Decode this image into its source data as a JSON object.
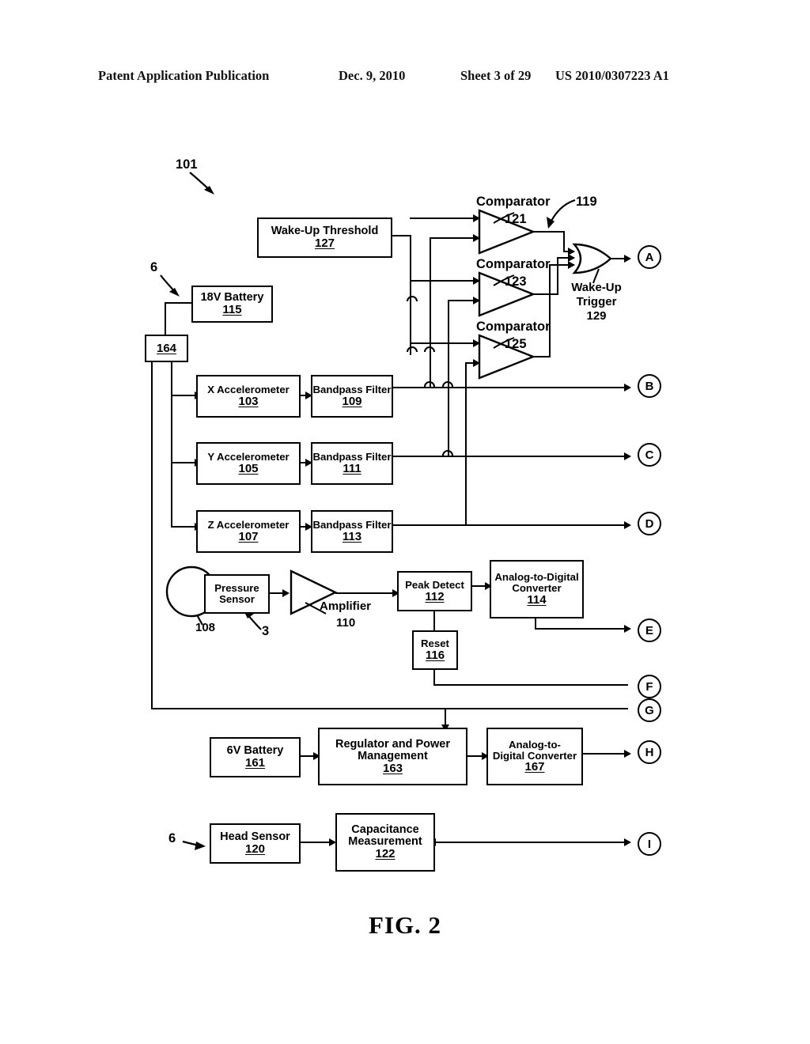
{
  "header": {
    "publication": "Patent Application Publication",
    "date": "Dec. 9, 2010",
    "sheet": "Sheet 3 of 29",
    "number": "US 2010/0307223 A1"
  },
  "figure": {
    "caption": "FIG. 2",
    "system_ref": "101",
    "group_ref_top": "6",
    "group_ref_bottom": "6",
    "group_ref_sensor": "3"
  },
  "blocks": {
    "wake_threshold": {
      "label": "Wake-Up Threshold",
      "num": "127"
    },
    "battery18": {
      "label": "18V Battery",
      "num": "115"
    },
    "node164": {
      "num": "164"
    },
    "x_accel": {
      "label": "X Accelerometer",
      "num": "103"
    },
    "y_accel": {
      "label": "Y Accelerometer",
      "num": "105"
    },
    "z_accel": {
      "label": "Z Accelerometer",
      "num": "107"
    },
    "bpf_x": {
      "label": "Bandpass Filter",
      "num": "109"
    },
    "bpf_y": {
      "label": "Bandpass Filter",
      "num": "111"
    },
    "bpf_z": {
      "label": "Bandpass Filter",
      "num": "113"
    },
    "pressure_sensor": {
      "label_line1": "Pressure",
      "label_line2": "Sensor",
      "num": "108"
    },
    "amplifier": {
      "label": "Amplifier",
      "num": "110"
    },
    "peak_detect": {
      "label": "Peak Detect",
      "num": "112"
    },
    "adc114": {
      "label_line1": "Analog-to-Digital",
      "label_line2": "Converter",
      "num": "114"
    },
    "reset": {
      "label": "Reset",
      "num": "116"
    },
    "battery6": {
      "label": "6V Battery",
      "num": "161"
    },
    "regulator": {
      "label_line1": "Regulator and Power",
      "label_line2": "Management",
      "num": "163"
    },
    "adc167": {
      "label_line1": "Analog-to-",
      "label_line2": "Digital Converter",
      "num": "167"
    },
    "head_sensor": {
      "label": "Head Sensor",
      "num": "120"
    },
    "capacitance": {
      "label_line1": "Capacitance",
      "label_line2": "Measurement",
      "num": "122"
    }
  },
  "comparators": {
    "group_ref": "119",
    "c1": {
      "label": "Comparator",
      "num": "121"
    },
    "c2": {
      "label": "Comparator",
      "num": "123"
    },
    "c3": {
      "label": "Comparator",
      "num": "125"
    },
    "or_gate": {
      "label_line1": "Wake-Up",
      "label_line2": "Trigger",
      "num": "129"
    }
  },
  "terminals": [
    {
      "id": "A"
    },
    {
      "id": "B"
    },
    {
      "id": "C"
    },
    {
      "id": "D"
    },
    {
      "id": "E"
    },
    {
      "id": "F"
    },
    {
      "id": "G"
    },
    {
      "id": "H"
    },
    {
      "id": "I"
    }
  ]
}
